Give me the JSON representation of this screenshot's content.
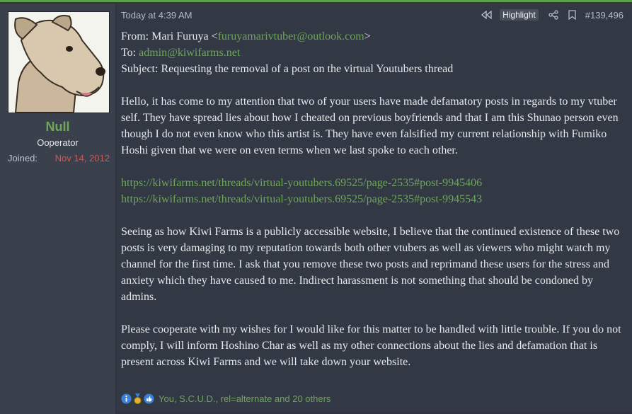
{
  "user": {
    "name": "Null",
    "title": "Ooperator",
    "joined_label": "Joined:",
    "joined_date": "Nov 14, 2012"
  },
  "post": {
    "timestamp": "Today at 4:39 AM",
    "highlight_label": "Highlight",
    "post_number": "#139,496",
    "from_label": "From: Mari Furuya <",
    "from_email": "furuyamarivtuber@outlook.com",
    "from_close": ">",
    "to_label": "To: ",
    "to_email": "admin@kiwifarms.net",
    "subject": "Subject: Requesting the removal of a post on the virtual Youtubers thread",
    "para1": "Hello, it has come to my attention that two of your users have made defamatory posts in regards to my vtuber self. They have spread lies about how I cheated on previous boyfriends and that I am this Shunao person even though I do not even know who this artist is. They have even falsified my current relationship with Fumiko Hoshi given that we were on even terms when we last spoke to each other.",
    "link1": "https://kiwifarms.net/threads/virtual-youtubers.69525/page-2535#post-9945406",
    "link2": "https://kiwifarms.net/threads/virtual-youtubers.69525/page-2535#post-9945543",
    "para2": "Seeing as how Kiwi Farms is a publicly accessible website, I believe that the continued existence of these two posts is very damaging to my reputation towards both other vtubers as well as viewers who might watch my channel for the first time. I ask that you remove these two posts and reprimand these users for the stress and anxiety which they have caused to me. Indirect harassment is not something that should be condoned by admins.",
    "para3": "Please cooperate with my wishes for I would like for this matter to be handled with little trouble. If you do not comply, I will inform Hoshino Char as well as my other connections about the lies and defamation that is present across Kiwi Farms and we will take down your website."
  },
  "reactions": {
    "icons": [
      "informative-icon",
      "medal-icon",
      "like-icon"
    ],
    "text": "You, S.C.U.D., rel=alternate and 20 others"
  },
  "colors": {
    "accent_green": "#6fa65c",
    "joined_red": "#d9534f",
    "background": "#323844"
  }
}
